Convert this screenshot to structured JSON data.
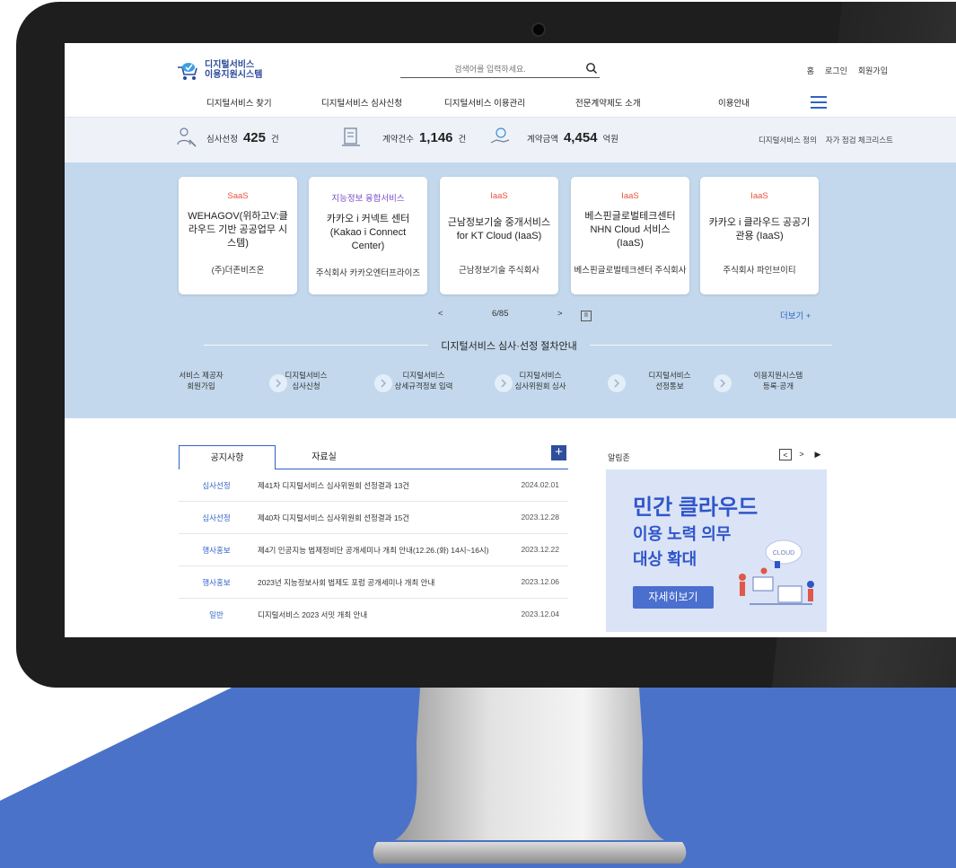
{
  "header": {
    "logo_line1": "디지털서비스",
    "logo_line2": "이용지원시스템",
    "search_placeholder": "검색어를 입력하세요.",
    "util_links": [
      "홈",
      "로그인",
      "회원가입"
    ]
  },
  "nav": {
    "items": [
      "디지털서비스 찾기",
      "디지털서비스 심사신청",
      "디지털서비스 이용관리",
      "전문계약제도 소개",
      "이용안내"
    ]
  },
  "stats": {
    "items": [
      {
        "label": "심사선정",
        "value": "425",
        "unit": "건"
      },
      {
        "label": "계약건수",
        "value": "1,146",
        "unit": "건"
      },
      {
        "label": "계약금액",
        "value": "4,454",
        "unit": "억원"
      }
    ],
    "links": [
      "디지털서비스 정의",
      "자가 점검 체크리스트"
    ]
  },
  "cards": [
    {
      "category": "SaaS",
      "category_color": "#e8513d",
      "title": "WEHAGOV(위하고V:클라우드 기반 공공업무 시스템)",
      "company": "(주)더존비즈온"
    },
    {
      "category": "지능정보 융합서비스",
      "category_color": "#7b4fc8",
      "title": "카카오 i 커넥트 센터(Kakao i Connect Center)",
      "company": "주식회사 카카오엔터프라이즈"
    },
    {
      "category": "IaaS",
      "category_color": "#e8513d",
      "title": "근남정보기술 중개서비스 for KT Cloud (IaaS)",
      "company": "근남정보기술 주식회사"
    },
    {
      "category": "IaaS",
      "category_color": "#e8513d",
      "title": "베스핀글로벌테크센터 NHN Cloud 서비스(IaaS)",
      "company": "베스핀글로벌테크센터 주식회사"
    },
    {
      "category": "IaaS",
      "category_color": "#e8513d",
      "title": "카카오 i 클라우드 공공기관용 (IaaS)",
      "company": "주식회사 파인브이티"
    }
  ],
  "pager": {
    "prev": "<",
    "current": "6/85",
    "next": ">",
    "pause": "II",
    "more": "더보기 +"
  },
  "process": {
    "title": "디지털서비스 심사·선정 절차안내",
    "steps": [
      {
        "line1": "서비스 제공자",
        "line2": "회원가입"
      },
      {
        "line1": "디지털서비스",
        "line2": "심사신청"
      },
      {
        "line1": "디지털서비스",
        "line2": "상세규격정보 입력"
      },
      {
        "line1": "디지털서비스",
        "line2": "심사위원회 심사"
      },
      {
        "line1": "디지털서비스",
        "line2": "선정통보"
      },
      {
        "line1": "이용지원시스템",
        "line2": "등록·공개"
      }
    ]
  },
  "board": {
    "tabs": [
      "공지사항",
      "자료실"
    ],
    "plus": "+",
    "rows": [
      {
        "category": "심사선정",
        "title": "제41차 디지털서비스 심사위원회 선정결과 13건",
        "date": "2024.02.01"
      },
      {
        "category": "심사선정",
        "title": "제40차 디지털서비스 심사위원회 선정결과 15건",
        "date": "2023.12.28"
      },
      {
        "category": "행사홍보",
        "title": "제4기 인공지능 법제정비단 공개세미나 개최 안내(12.26.(화) 14시~16시)",
        "date": "2023.12.22"
      },
      {
        "category": "행사홍보",
        "title": "2023년 지능정보사회 법제도 포럼 공개세미나 개최 안내",
        "date": "2023.12.06"
      },
      {
        "category": "일반",
        "title": "디지털서비스 2023 서밋 개최 안내",
        "date": "2023.12.04"
      }
    ]
  },
  "notice": {
    "title": "알림존",
    "ctrl_prev": "<",
    "ctrl_next": ">",
    "ctrl_play": "▶",
    "banner_line1": "민간 클라우드",
    "banner_line2": "이용 노력 의무",
    "banner_line3": "대상 확대",
    "banner_cloud_text": "CLOUD",
    "banner_button": "자세히보기"
  },
  "colors": {
    "brand_blue": "#2f62c6",
    "background_blue": "#4a72c9",
    "hero_bg": "#c3d8ec",
    "bezel": "#1e1e1e"
  }
}
